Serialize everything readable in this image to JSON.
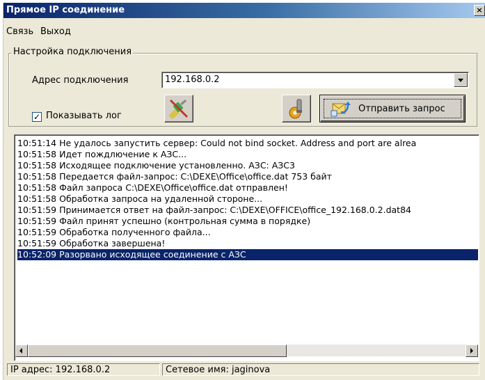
{
  "window": {
    "title": "Прямое IP соединение",
    "close_glyph": "×"
  },
  "menu": {
    "items": [
      "Связь",
      "Выход"
    ]
  },
  "settings": {
    "group_title": "Настройка подключения",
    "address_label": "Адрес подключения",
    "address_value": "192.168.0.2",
    "show_log_label": "Показывать лог",
    "show_log_checked": true,
    "check_glyph": "✓",
    "send_button_label": "Отправить запрос"
  },
  "log": {
    "selected_index": 10,
    "lines": [
      "10:51:14 Не удалось запустить сервер: Could not bind socket. Address and port are alrea",
      "10:51:58 Идет пождлючение к АЗС...",
      "10:51:58 Исходящее подключение установленно. АЗС: АЗС3",
      "10:51:58 Передается файл-запрос: C:\\DEXE\\Office\\office.dat 753 байт",
      "10:51:58 Файл запроса C:\\DEXE\\Office\\office.dat отправлен!",
      "10:51:58 Обработка запроса на удаленной стороне...",
      "10:51:59 Принимается ответ на файл-запрос: C:\\DEXE\\OFFICE\\office_192.168.0.2.dat84",
      "10:51:59 Файл принят успешно (контрольная сумма в порядке)",
      "10:51:59 Обработка полученного файла...",
      "10:51:59 Обработка завершена!",
      "10:52:09 Разорвано исходящее соединение с АЗС"
    ]
  },
  "status": {
    "ip_text": "IP адрес: 192.168.0.2",
    "hostname_text": "Сетевое имя: jaginova"
  },
  "icons": {
    "disconnect": "unplug-icon",
    "settings": "settings-gear-icon",
    "send": "send-request-icon"
  },
  "colors": {
    "title_start": "#0a246a",
    "title_end": "#a6caf0",
    "selection": "#0a246a",
    "face": "#ece9d8"
  }
}
